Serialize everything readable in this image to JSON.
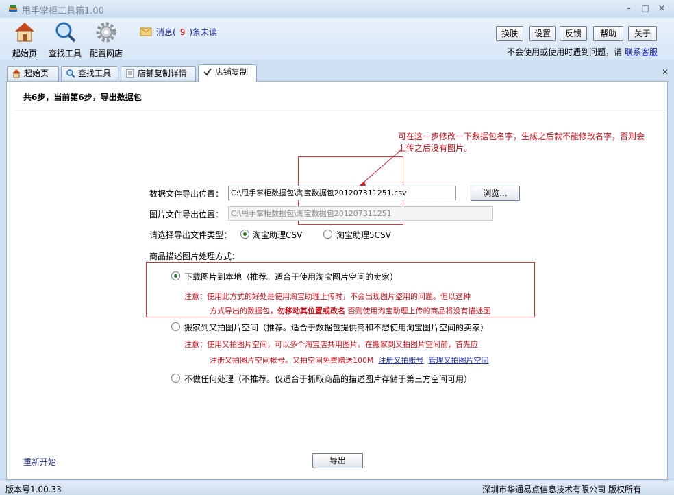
{
  "app": {
    "title": "甩手掌柜工具箱1.00"
  },
  "toolbar": {
    "items": [
      {
        "label": "起始页",
        "icon": "home-icon"
      },
      {
        "label": "查找工具",
        "icon": "magnifier-icon"
      },
      {
        "label": "配置网店",
        "icon": "gear-icon"
      }
    ],
    "message": {
      "prefix": "消息(",
      "count": "9",
      "suffix": ")条未读",
      "icon": "mail-icon"
    },
    "buttons": [
      "换肤",
      "设置",
      "反馈",
      "帮助",
      "关于"
    ],
    "help_text": "不会使用或使用时遇到问题，请",
    "help_link": "联系客服"
  },
  "tabs": [
    {
      "label": "起始页",
      "icon": "home-icon"
    },
    {
      "label": "查找工具",
      "icon": "magnifier-icon"
    },
    {
      "label": "店铺复制详情",
      "icon": "document-icon"
    },
    {
      "label": "店铺复制",
      "icon": "check-icon",
      "active": true
    }
  ],
  "content": {
    "step_title": "共6步，当前第6步，导出数据包",
    "annotation": "可在这一步修改一下数据包名字，生成之后就不能修改名字，否则会上传之后没有图片。",
    "data_file_label": "数据文件导出位置：",
    "data_file_value": "C:\\甩手掌柜数据包\\淘宝数据包201207311251.csv",
    "browse_button": "浏览...",
    "image_file_label": "图片文件导出位置：",
    "image_file_value": "C:\\甩手掌柜数据包\\淘宝数据包201207311251",
    "type_label": "请选择导出文件类型：",
    "type_options": [
      {
        "label": "淘宝助理CSV",
        "selected": true
      },
      {
        "label": "淘宝助理5CSV",
        "selected": false
      }
    ],
    "desc_label": "商品描述图片处理方式：",
    "options": [
      {
        "label": "下载图片到本地（推荐。适合于使用淘宝图片空间的卖家）",
        "selected": true,
        "note_line1": "注意：使用此方式的好处是使用淘宝助理上传时，不会出现图片盗用的问题。但以这种",
        "note_line2_a": "方式导出的数据包，",
        "note_line2_b": "勿移动其位置或改名",
        "note_line2_c": " 否则使用淘宝助理上传的商品将没有描述图"
      },
      {
        "label": "搬家到又拍图片空间（推荐。适合于数据包提供商和不想使用淘宝图片空间的卖家）",
        "selected": false,
        "note_line1": "注意：使用又拍图片空间，可以多个淘宝店共用图片。在搬家到又拍图片空间前，首先应",
        "note_line2": "注册又拍图片空间帐号。又拍空间免费赠送100M",
        "link1": "注册又拍账号",
        "link2": "管理又拍图片空间"
      },
      {
        "label": "不做任何处理（不推荐。仅适合于抓取商品的描述图片存储于第三方空间可用）",
        "selected": false
      }
    ],
    "restart_link": "重新开始",
    "export_button": "导出"
  },
  "status": {
    "version": "版本号1.00.33",
    "copyright": "深圳市华通易点信息技术有限公司 版权所有"
  },
  "colors": {
    "annotation_red": "#c8141e",
    "link_blue": "#1a2aa8",
    "frame_blue": "#cfe0f3"
  }
}
